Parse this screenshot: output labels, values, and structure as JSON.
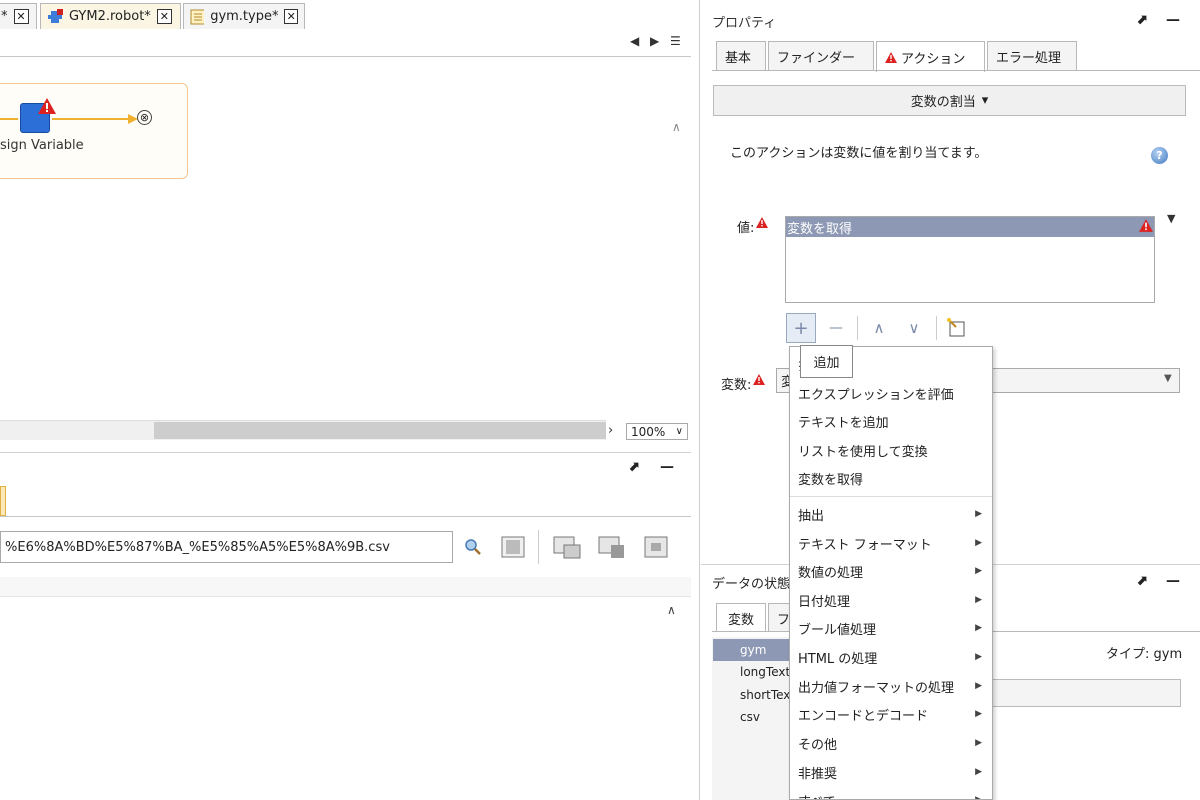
{
  "editor": {
    "tabs": [
      {
        "label": "*",
        "close": "✕"
      },
      {
        "label": "GYM2.robot*",
        "close": "✕"
      },
      {
        "label": "gym.type*",
        "close": "✕"
      }
    ],
    "nav_left": "◀",
    "nav_right": "▶",
    "nav_list": "☰",
    "step_label": "sign Variable",
    "end_symbol": "⊗",
    "zoom": "100%",
    "zoom_arrow": "∨",
    "scroll_up": "∧",
    "scroll_down": "∨",
    "scroll_right": "›"
  },
  "lower_view": {
    "url": "%E6%8A%BD%E5%87%BA_%E5%85%A5%E5%8A%9B.csv",
    "scroll_up": "∧",
    "maximize": "⬈",
    "minimize": "—"
  },
  "properties": {
    "title": "プロパティ",
    "maximize": "⬈",
    "minimize": "—",
    "tabs": [
      "基本",
      "ファインダー",
      "アクション",
      "エラー処理"
    ],
    "action_select": "変数の割当",
    "action_select_arrow": "▾",
    "description": "このアクションは変数に値を割り当てます。",
    "help": "?",
    "value_label": "値:",
    "value_items": [
      "変数を取得"
    ],
    "value_dropdown_arrow": "▼",
    "toolbar": {
      "add": "+",
      "remove": "—",
      "up": "∧",
      "down": "∨"
    },
    "tooltip": "追加",
    "variable_label": "変数:",
    "variable_value": "変",
    "variable_select_arrow": "▼"
  },
  "context_menu": {
    "items": [
      {
        "label": "扌",
        "submenu": false
      },
      {
        "label": "エクスプレッションを評価",
        "submenu": false
      },
      {
        "label": "テキストを追加",
        "submenu": false
      },
      {
        "label": "リストを使用して変換",
        "submenu": false
      },
      {
        "label": "変数を取得",
        "submenu": false
      },
      {
        "label": "抽出",
        "submenu": true
      },
      {
        "label": "テキスト フォーマット",
        "submenu": true
      },
      {
        "label": "数値の処理",
        "submenu": true
      },
      {
        "label": "日付処理",
        "submenu": true
      },
      {
        "label": "ブール値処理",
        "submenu": true
      },
      {
        "label": "HTML の処理",
        "submenu": true
      },
      {
        "label": "出力値フォーマットの処理",
        "submenu": true
      },
      {
        "label": "エンコードとデコード",
        "submenu": true
      },
      {
        "label": "その他",
        "submenu": true
      },
      {
        "label": "非推奨",
        "submenu": true
      },
      {
        "label": "すべて",
        "submenu": true
      }
    ],
    "submenu_arrow": "▶"
  },
  "data_state": {
    "title": "データの状態",
    "maximize": "⬈",
    "minimize": "—",
    "tabs": [
      "変数",
      "フ"
    ],
    "variables": [
      "gym",
      "longText",
      "shortText",
      "csv"
    ],
    "type_label": "タイプ: gym"
  }
}
